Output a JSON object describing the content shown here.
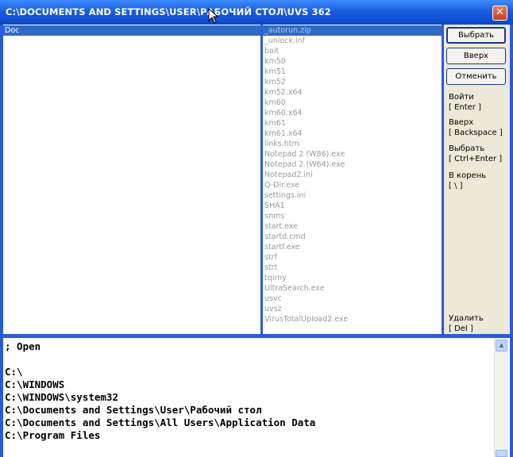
{
  "window": {
    "title": "C:\\DOCUMENTS AND SETTINGS\\USER\\РАБОЧИЙ СТОЛ\\UVS 362",
    "close_label": "✕"
  },
  "left_pane": {
    "selected_item": "Doc"
  },
  "right_pane": {
    "files": [
      "_autorun.zip",
      "_unlock.inf",
      "bait",
      "km50",
      "km51",
      "km52",
      "km52.x64",
      "km60",
      "km60.x64",
      "km61",
      "km61.x64",
      "links.htm",
      "Notepad 2 (W86).exe",
      "Notepad 2.(W64).exe",
      "Notepad2.ini",
      "Q-Dir.exe",
      "settings.ini",
      "SHA1",
      "snms",
      "start.exe",
      "startd.cmd",
      "startf.exe",
      "strf",
      "strt",
      "tqirny",
      "UltraSearch.exe",
      "usvc",
      "uvsz",
      "VirusTotalUpload2.exe"
    ],
    "selected_index": 0
  },
  "side_panel": {
    "select_button": "Выбрать",
    "up_button": "Вверх",
    "cancel_button": "Отменить",
    "hints": {
      "enter_label": "Войти",
      "enter_key": "[ Enter ]",
      "up_label": "Вверх",
      "up_key": "[ Backspace ]",
      "select_label": "Выбрать",
      "select_key": "[ Ctrl+Enter ]",
      "root_label": "В корень",
      "root_key": "[ \\ ]",
      "delete_label": "Удалить",
      "delete_key": "[ Del ]"
    }
  },
  "editor": {
    "lines": [
      "; Open",
      "",
      "C:\\",
      "C:\\WINDOWS",
      "C:\\WINDOWS\\system32",
      "C:\\Documents and Settings\\User\\Рабочий стол",
      "C:\\Documents and Settings\\All Users\\Application Data",
      "C:\\Program Files"
    ]
  },
  "icons": {
    "close": "close-icon",
    "scroll_up": "scroll-up-arrow-icon",
    "cursor": "mouse-cursor-icon"
  }
}
